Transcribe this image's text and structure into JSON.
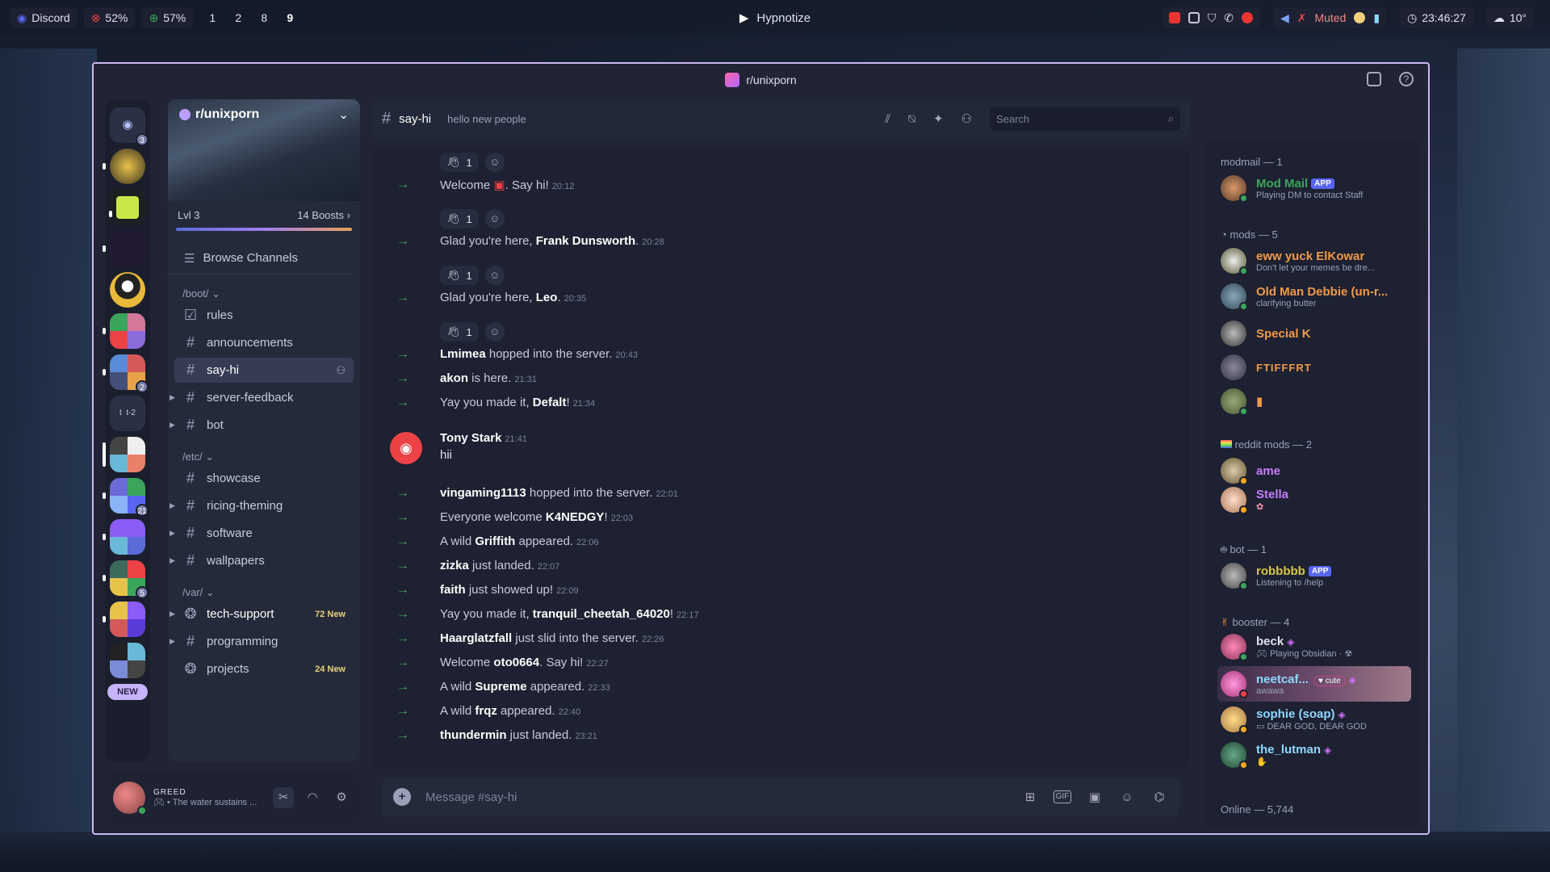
{
  "topbar": {
    "app": "Discord",
    "cpu": "52%",
    "mem": "57%",
    "workspaces": [
      "1",
      "2",
      "8",
      "9"
    ],
    "media_title": "Hypnotize",
    "mic_status": "Muted",
    "clock": "23:46:27",
    "weather": "10°"
  },
  "window": {
    "title": "r/unixporn"
  },
  "server": {
    "name": "r/unixporn",
    "level": "Lvl 3",
    "boosts": "14 Boosts",
    "browse_label": "Browse Channels",
    "categories": [
      {
        "name": "/boot/",
        "channels": [
          {
            "name": "rules"
          },
          {
            "name": "announcements"
          },
          {
            "name": "say-hi"
          },
          {
            "name": "server-feedback"
          },
          {
            "name": "bot"
          }
        ]
      },
      {
        "name": "/etc/",
        "channels": [
          {
            "name": "showcase"
          },
          {
            "name": "ricing-theming"
          },
          {
            "name": "software"
          },
          {
            "name": "wallpapers"
          }
        ]
      },
      {
        "name": "/var/",
        "channels": [
          {
            "name": "tech-support",
            "badge": "72 New"
          },
          {
            "name": "programming"
          },
          {
            "name": "projects",
            "badge": "24 New"
          }
        ]
      }
    ],
    "new_badge": "NEW"
  },
  "guild_badges": [
    "3",
    "2",
    "21",
    "5"
  ],
  "user": {
    "name": "GREED",
    "status": "• The water sustains ..."
  },
  "channel": {
    "name": "say-hi",
    "topic": "hello new people",
    "search_placeholder": "Search",
    "composer_placeholder": "Message #say-hi"
  },
  "messages": [
    {
      "pre": "Welcome ",
      "name": "",
      "post": ". Say hi!",
      "time": "20:12"
    },
    {
      "pre": "Glad you're here, ",
      "name": "Frank Dunsworth",
      "post": ".",
      "time": "20:28"
    },
    {
      "pre": "Glad you're here, ",
      "name": "Leo",
      "post": ".",
      "time": "20:35"
    },
    {
      "pre": "",
      "name": "Lmimea",
      "post": " hopped into the server.",
      "time": "20:43"
    },
    {
      "pre": "",
      "name": "akon",
      "post": " is here.",
      "time": "21:31"
    },
    {
      "pre": "Yay you made it, ",
      "name": "Defalt",
      "post": "!",
      "time": "21:34"
    },
    {
      "pre": "",
      "name": "vingaming1113",
      "post": " hopped into the server.",
      "time": "22:01"
    },
    {
      "pre": "Everyone welcome ",
      "name": "K4NEDGY",
      "post": "!",
      "time": "22:03"
    },
    {
      "pre": "A wild ",
      "name": "Griffith",
      "post": " appeared.",
      "time": "22:06"
    },
    {
      "pre": "",
      "name": "zizka",
      "post": " just landed.",
      "time": "22:07"
    },
    {
      "pre": "",
      "name": "faith",
      "post": " just showed up!",
      "time": "22:09"
    },
    {
      "pre": "Yay you made it, ",
      "name": "tranquil_cheetah_64020",
      "post": "!",
      "time": "22:17"
    },
    {
      "pre": "",
      "name": "Haarglatzfall",
      "post": " just slid into the server.",
      "time": "22:26"
    },
    {
      "pre": "Welcome ",
      "name": "oto0664",
      "post": ". Say hi!",
      "time": "22:27"
    },
    {
      "pre": "A wild ",
      "name": "Supreme",
      "post": " appeared.",
      "time": "22:33"
    },
    {
      "pre": "A wild ",
      "name": "frqz",
      "post": " appeared.",
      "time": "22:40"
    },
    {
      "pre": "",
      "name": "thundermin",
      "post": " just landed.",
      "time": "23:21"
    }
  ],
  "reaction_count": "1",
  "tony": {
    "name": "Tony Stark",
    "time": "21:41",
    "text": "hii"
  },
  "member_groups": [
    {
      "label": "modmail — 1"
    },
    {
      "label": "mods — 5"
    },
    {
      "label": "reddit mods — 2"
    },
    {
      "label": "bot — 1"
    },
    {
      "label": "booster — 4"
    }
  ],
  "members": [
    {
      "name": "Mod Mail",
      "badge": "APP",
      "sub": "Playing DM to contact Staff",
      "color": "#3ba55c"
    },
    {
      "name": "eww yuck ElKowar",
      "sub": "Don't let your memes be dre...",
      "color": "#f09a4a"
    },
    {
      "name": "Old Man Debbie (un-r...",
      "sub": "clarifying butter",
      "color": "#f09a4a"
    },
    {
      "name": "Special K",
      "sub": "",
      "color": "#f09a4a"
    },
    {
      "name": "FTIFFFRT",
      "sub": "",
      "color": "#f09a4a"
    },
    {
      "name": "",
      "sub": "",
      "color": "#f09a4a"
    },
    {
      "name": "ame",
      "sub": "",
      "color": "#c77dff"
    },
    {
      "name": "Stella",
      "sub": "",
      "color": "#c77dff"
    },
    {
      "name": "robbbbb",
      "badge": "APP",
      "sub": "Listening to /help",
      "color": "#d4c64a"
    },
    {
      "name": "beck",
      "sub": "Playing Obsidian ·",
      "color": "#dfe3ec"
    },
    {
      "name": "neetcaf...",
      "tag": "cute",
      "sub": "awawa",
      "color": "#8fd8ff"
    },
    {
      "name": "sophie (soap)",
      "sub": "DEAR GOD, DEAR GOD",
      "color": "#8fd8ff"
    },
    {
      "name": "the_lutman",
      "sub": "",
      "color": "#8fd8ff"
    }
  ],
  "online": "Online — 5,744"
}
